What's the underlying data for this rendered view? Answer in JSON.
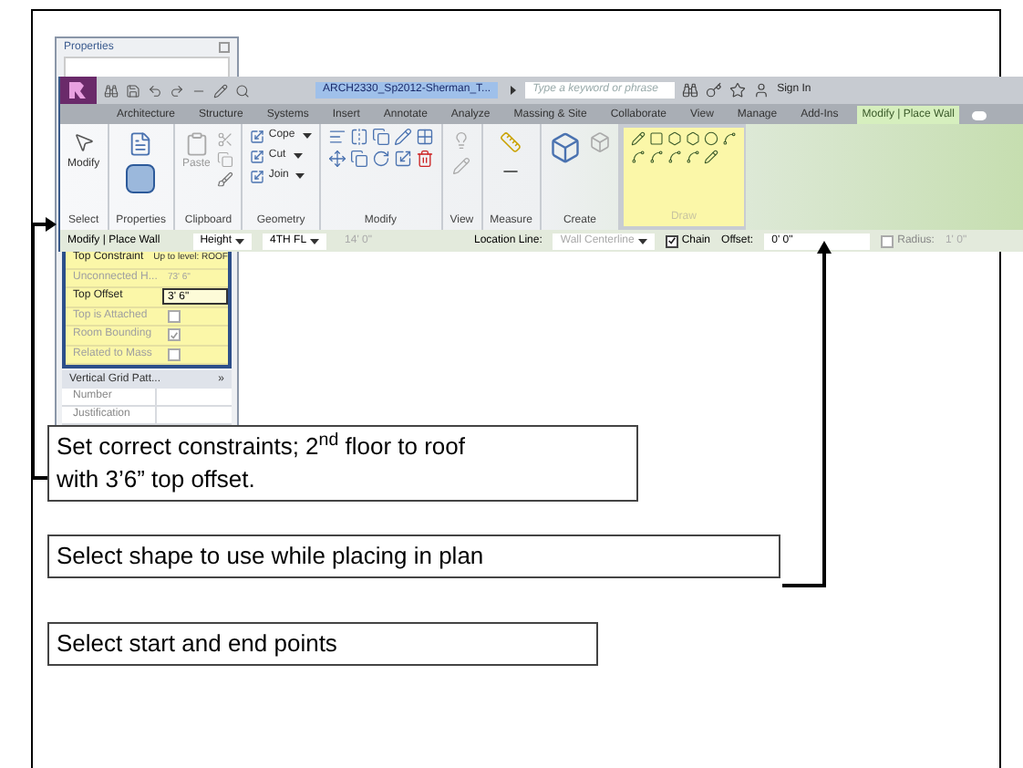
{
  "properties_panel": {
    "title": "Properties",
    "rows": [
      {
        "label": "Top Constraint",
        "value": "Up to level: ROOF",
        "kind": "text",
        "disabled": false
      },
      {
        "label": "Unconnected H...",
        "value": "73' 6\"",
        "kind": "text",
        "disabled": true
      },
      {
        "label": "Top Offset",
        "value": "3' 6\"",
        "kind": "input",
        "disabled": false
      },
      {
        "label": "Top is Attached",
        "kind": "checkbox",
        "checked": false,
        "disabled": true
      },
      {
        "label": "Room Bounding",
        "kind": "checkbox",
        "checked": true,
        "disabled": true
      },
      {
        "label": "Related to Mass",
        "kind": "checkbox",
        "checked": false,
        "disabled": true
      }
    ],
    "group": {
      "title": "Vertical Grid Patt...",
      "toggle": "»"
    },
    "group_rows": [
      {
        "label": "Number"
      },
      {
        "label": "Justification"
      }
    ]
  },
  "title_bar": {
    "file_title": "ARCH2330_Sp2012-Sherman_T...",
    "search_placeholder": "Type a keyword or phrase",
    "sign_in": "Sign In"
  },
  "ribbon_tabs": [
    {
      "label": "Architecture",
      "selected": false
    },
    {
      "label": "Structure",
      "selected": false
    },
    {
      "label": "Systems",
      "selected": false
    },
    {
      "label": "Insert",
      "selected": false
    },
    {
      "label": "Annotate",
      "selected": false
    },
    {
      "label": "Analyze",
      "selected": false
    },
    {
      "label": "Massing & Site",
      "selected": false
    },
    {
      "label": "Collaborate",
      "selected": false
    },
    {
      "label": "View",
      "selected": false
    },
    {
      "label": "Manage",
      "selected": false
    },
    {
      "label": "Add-Ins",
      "selected": false
    },
    {
      "label": "Modify | Place Wall",
      "selected": true
    }
  ],
  "panels": [
    {
      "kind": "select",
      "title": "Select",
      "tools": [
        "Modify"
      ]
    },
    {
      "kind": "properties",
      "title": "Properties"
    },
    {
      "kind": "clipboard",
      "title": "Clipboard",
      "tools": [
        "Paste"
      ]
    },
    {
      "kind": "geometry",
      "title": "Geometry",
      "tools": [
        "Cope",
        "Cut",
        "Join"
      ]
    },
    {
      "kind": "modify",
      "title": "Modify"
    },
    {
      "kind": "view",
      "title": "View"
    },
    {
      "kind": "measure",
      "title": "Measure"
    },
    {
      "kind": "create",
      "title": "Create"
    },
    {
      "kind": "draw",
      "title": "Draw"
    }
  ],
  "options_bar": {
    "context": "Modify | Place Wall",
    "height_mode": "Height",
    "level": "4TH FL",
    "height_value": "14' 0\"",
    "location_label": "Location Line:",
    "location_value": "Wall Centerline",
    "chain": {
      "label": "Chain",
      "checked": true
    },
    "offset_label": "Offset:",
    "offset_value": "0' 0\"",
    "radius": {
      "label": "Radius:",
      "checked": false
    },
    "radius_value": "1' 0\""
  },
  "callouts": [
    {
      "text": "Set correct constraints; 2$^{nd}$ floor to roof with 3’6” top offset."
    },
    {
      "text": "Select shape to use while placing in plan"
    },
    {
      "text": "Select start and end points"
    }
  ]
}
